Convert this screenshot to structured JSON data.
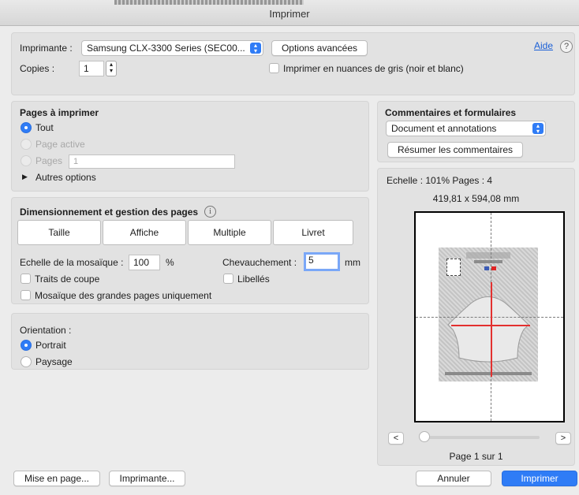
{
  "window": {
    "title": "Imprimer"
  },
  "printer": {
    "label": "Imprimante :",
    "selected": "Samsung CLX-3300 Series (SEC00...",
    "advanced_button": "Options avancées",
    "help_link": "Aide",
    "help_icon_glyph": "?"
  },
  "copies": {
    "label": "Copies :",
    "value": "1",
    "grayscale_label": "Imprimer en nuances de gris (noir et blanc)"
  },
  "pages": {
    "heading": "Pages à imprimer",
    "all": "Tout",
    "current": "Page active",
    "range": "Pages",
    "range_value": "1",
    "more": "Autres options"
  },
  "comments": {
    "heading": "Commentaires et formulaires",
    "selected": "Document et annotations",
    "summarize_button": "Résumer les commentaires"
  },
  "sizing": {
    "heading": "Dimensionnement et gestion des pages",
    "info_glyph": "i",
    "tabs": [
      "Taille",
      "Affiche",
      "Multiple",
      "Livret"
    ],
    "tile_scale_label": "Echelle de la mosaïque :",
    "tile_scale_value": "100",
    "tile_scale_unit": "%",
    "overlap_label": "Chevauchement :",
    "overlap_value": "5",
    "overlap_unit": "mm",
    "cut_marks": "Traits de coupe",
    "labels": "Libellés",
    "large_pages_only": "Mosaïque des grandes pages uniquement"
  },
  "orientation": {
    "heading": "Orientation :",
    "portrait": "Portrait",
    "landscape": "Paysage"
  },
  "preview": {
    "scale_info": "Echelle : 101% Pages : 4",
    "dimensions": "419,81 x 594,08 mm",
    "prev": "<",
    "next": ">",
    "page_indicator": "Page 1 sur 1"
  },
  "footer": {
    "page_setup": "Mise en page...",
    "printer": "Imprimante...",
    "cancel": "Annuler",
    "print": "Imprimer"
  },
  "colors": {
    "accent": "#2f7cf6",
    "link": "#1a5fd6",
    "preview_guides": "#e3302f"
  }
}
